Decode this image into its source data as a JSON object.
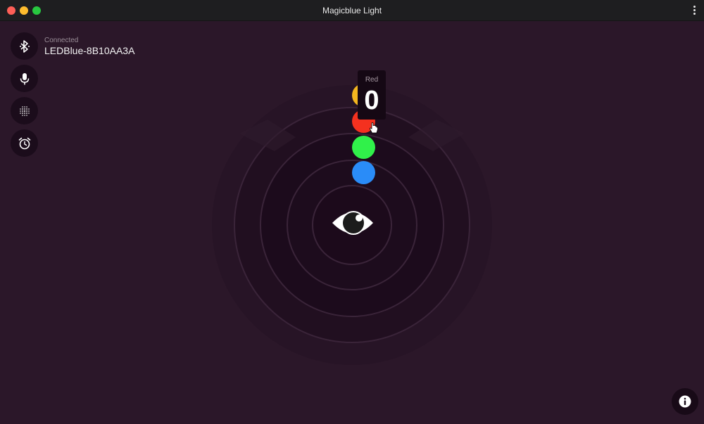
{
  "window": {
    "title": "Magicblue Light"
  },
  "connection": {
    "status_label": "Connected",
    "device_name": "LEDBlue-8B10AA3A"
  },
  "sidebar": {
    "items": [
      {
        "icon": "bluetooth-icon"
      },
      {
        "icon": "microphone-icon"
      },
      {
        "icon": "dot-grid-icon"
      },
      {
        "icon": "alarm-clock-icon"
      }
    ]
  },
  "color_picker": {
    "dots": [
      {
        "name": "yellow",
        "color": "#f3b61f"
      },
      {
        "name": "red",
        "color": "#f4311f"
      },
      {
        "name": "green",
        "color": "#30f14a"
      },
      {
        "name": "blue",
        "color": "#2a8cf8"
      }
    ],
    "tooltip": {
      "label": "Red",
      "value": "0"
    }
  },
  "center": {
    "icon": "eye-icon"
  },
  "footer": {
    "info_icon": "info-icon"
  }
}
